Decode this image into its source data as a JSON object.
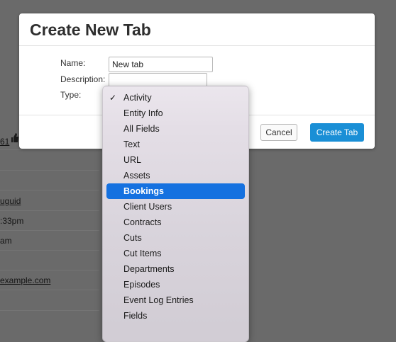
{
  "background": {
    "fragments": [
      "61",
      "uguid",
      ":33pm",
      "am",
      "example.com"
    ]
  },
  "modal": {
    "title": "Create New Tab",
    "fields": {
      "name_label": "Name:",
      "name_value": "New tab",
      "description_label": "Description:",
      "type_label": "Type:"
    },
    "buttons": {
      "cancel": "Cancel",
      "create": "Create Tab"
    }
  },
  "type_menu": {
    "selected": "Activity",
    "highlighted": "Bookings",
    "items": [
      "Activity",
      "Entity Info",
      "All Fields",
      "Text",
      "URL",
      "Assets",
      "Bookings",
      "Client Users",
      "Contracts",
      "Cuts",
      "Cut Items",
      "Departments",
      "Episodes",
      "Event Log Entries",
      "Fields"
    ],
    "colors": {
      "highlight": "#1571e0",
      "primary_button": "#1a8fd6"
    }
  }
}
